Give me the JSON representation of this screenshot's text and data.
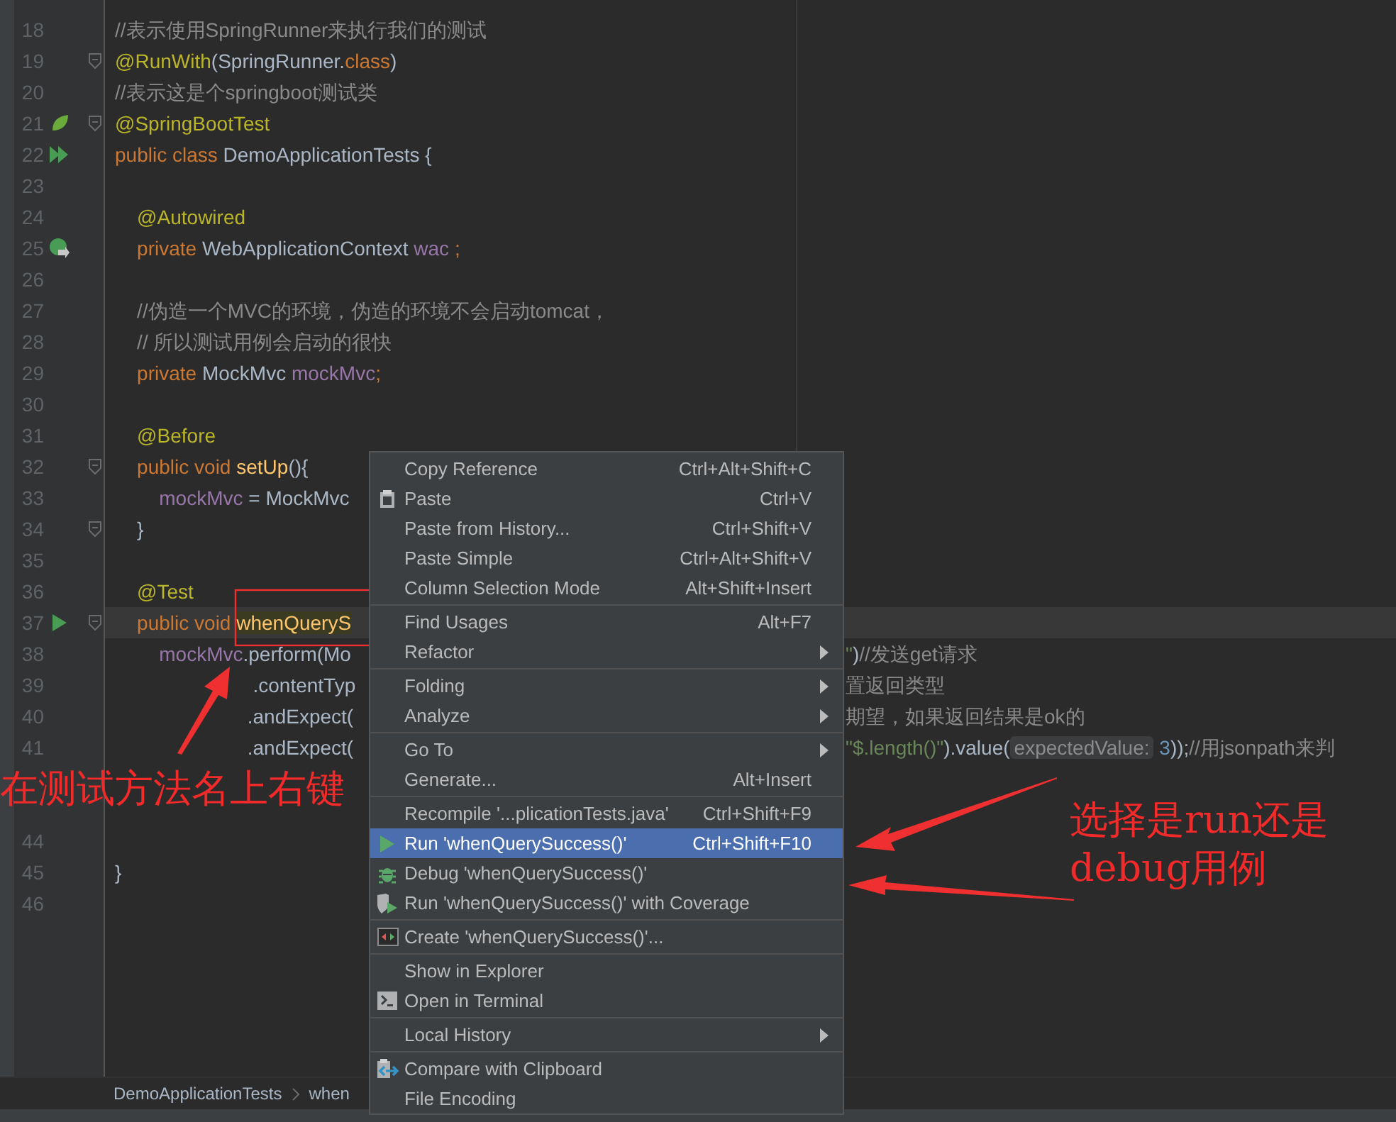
{
  "editor": {
    "lines": [
      {
        "number": "18",
        "kind": "plain",
        "fold": false,
        "current": false,
        "tokens": [
          {
            "kind": "comment",
            "text": "//表示使用SpringRunner来执行我们的测试"
          }
        ]
      },
      {
        "number": "19",
        "kind": "plain",
        "fold": true,
        "current": false,
        "tokens": [
          {
            "kind": "annotation",
            "text": "@RunWith"
          },
          {
            "kind": "plain",
            "text": "(SpringRunner."
          },
          {
            "kind": "keyword",
            "text": "class"
          },
          {
            "kind": "plain",
            "text": ")"
          }
        ]
      },
      {
        "number": "20",
        "kind": "plain",
        "fold": false,
        "current": false,
        "tokens": [
          {
            "kind": "comment",
            "text": "//表示这是个springboot测试类"
          }
        ]
      },
      {
        "number": "21",
        "kind": "leaf",
        "fold": true,
        "current": false,
        "tokens": [
          {
            "kind": "annotation",
            "text": "@SpringBootTest"
          }
        ]
      },
      {
        "number": "22",
        "kind": "run-all",
        "fold": false,
        "current": false,
        "tokens": [
          {
            "kind": "keyword",
            "text": "public class "
          },
          {
            "kind": "plain",
            "text": "DemoApplicationTests {"
          }
        ]
      },
      {
        "number": "23",
        "kind": "plain",
        "fold": false,
        "current": false
      },
      {
        "number": "24",
        "kind": "plain",
        "fold": false,
        "current": false,
        "tokens": [
          {
            "kind": "annotation",
            "text": "    @Autowired"
          }
        ]
      },
      {
        "number": "25",
        "kind": "bean",
        "fold": false,
        "current": false,
        "tokens": [
          {
            "kind": "keyword",
            "text": "    private "
          },
          {
            "kind": "plain",
            "text": "WebApplicationContext "
          },
          {
            "kind": "field",
            "text": "wac "
          },
          {
            "kind": "keyword",
            "text": ";"
          }
        ]
      },
      {
        "number": "26",
        "kind": "plain",
        "fold": false,
        "current": false
      },
      {
        "number": "27",
        "kind": "plain",
        "fold": false,
        "current": false,
        "tokens": [
          {
            "kind": "comment",
            "text": "    //伪造一个MVC的环境，伪造的环境不会启动tomcat，"
          }
        ]
      },
      {
        "number": "28",
        "kind": "plain",
        "fold": false,
        "current": false,
        "tokens": [
          {
            "kind": "comment",
            "text": "    // 所以测试用例会启动的很快"
          }
        ]
      },
      {
        "number": "29",
        "kind": "plain",
        "fold": false,
        "current": false,
        "tokens": [
          {
            "kind": "keyword",
            "text": "    private "
          },
          {
            "kind": "plain",
            "text": "MockMvc "
          },
          {
            "kind": "field",
            "text": "mockMvc"
          },
          {
            "kind": "keyword",
            "text": ";"
          }
        ]
      },
      {
        "number": "30",
        "kind": "plain",
        "fold": false,
        "current": false
      },
      {
        "number": "31",
        "kind": "plain",
        "fold": false,
        "current": false,
        "tokens": [
          {
            "kind": "annotation",
            "text": "    @Before"
          }
        ]
      },
      {
        "number": "32",
        "kind": "plain",
        "fold": true,
        "current": false,
        "tokens": [
          {
            "kind": "keyword",
            "text": "    public void "
          },
          {
            "kind": "method",
            "text": "setUp"
          },
          {
            "kind": "plain",
            "text": "(){"
          }
        ]
      },
      {
        "number": "33",
        "kind": "plain",
        "fold": false,
        "current": false,
        "tokens": [
          {
            "kind": "field",
            "text": "        mockMvc"
          },
          {
            "kind": "plain",
            "text": " = MockMvc"
          }
        ]
      },
      {
        "number": "34",
        "kind": "plain",
        "fold": true,
        "current": false,
        "tokens": [
          {
            "kind": "plain",
            "text": "    }"
          }
        ]
      },
      {
        "number": "35",
        "kind": "plain",
        "fold": false,
        "current": false
      },
      {
        "number": "36",
        "kind": "plain",
        "fold": false,
        "current": false,
        "tokens": [
          {
            "kind": "annotation",
            "text": "    @Test"
          }
        ]
      },
      {
        "number": "37",
        "kind": "run",
        "fold": true,
        "current": true,
        "tokens": [
          {
            "kind": "keyword",
            "text": "    public void "
          },
          {
            "kind": "method-highlight",
            "text": "whenQueryS"
          }
        ]
      },
      {
        "number": "38",
        "kind": "plain",
        "fold": false,
        "current": false,
        "tokens": [
          {
            "kind": "field",
            "text": "        mockMvc"
          },
          {
            "kind": "plain",
            "text": ".perform(Mo"
          }
        ],
        "tail": [
          {
            "kind": "string",
            "text": "\""
          },
          {
            "kind": "plain",
            "text": ")"
          },
          {
            "kind": "comment",
            "text": "//发送get请求"
          }
        ]
      },
      {
        "number": "39",
        "kind": "plain",
        "fold": false,
        "current": false,
        "tokens": [
          {
            "kind": "plain",
            "text": "                         .contentTyp"
          }
        ],
        "tail": [
          {
            "kind": "comment",
            "text": "置返回类型"
          }
        ]
      },
      {
        "number": "40",
        "kind": "plain",
        "fold": false,
        "current": false,
        "tokens": [
          {
            "kind": "plain",
            "text": "                        .andExpect("
          }
        ],
        "tail": [
          {
            "kind": "comment",
            "text": "期望，如果返回结果是ok的"
          }
        ]
      },
      {
        "number": "41",
        "kind": "plain",
        "fold": false,
        "current": false,
        "tokens": [
          {
            "kind": "plain",
            "text": "                        .andExpect("
          }
        ],
        "tail": [
          {
            "kind": "string",
            "text": "\"$.length()\""
          },
          {
            "kind": "plain",
            "text": ").value("
          },
          {
            "kind": "hint",
            "text": "expectedValue:"
          },
          {
            "kind": "number",
            "text": " 3"
          },
          {
            "kind": "plain",
            "text": "));"
          },
          {
            "kind": "comment",
            "text": "//用jsonpath来判"
          }
        ]
      },
      {
        "kind": "plain",
        "fold": false,
        "current": false
      },
      {
        "kind": "plain",
        "fold": false,
        "current": false
      },
      {
        "number": "44",
        "kind": "plain",
        "fold": false,
        "current": false
      },
      {
        "number": "45",
        "kind": "plain",
        "fold": false,
        "current": false,
        "tokens": [
          {
            "kind": "plain",
            "text": "}"
          }
        ]
      },
      {
        "number": "46",
        "kind": "plain",
        "fold": false,
        "current": false
      }
    ]
  },
  "breadcrumbs": [
    "DemoApplicationTests",
    "when"
  ],
  "context_menu": [
    {
      "kind": "plain",
      "label": "Copy Reference",
      "shortcut": "Ctrl+Alt+Shift+C",
      "submenu": false,
      "selected": false
    },
    {
      "kind": "clipboard",
      "label": "Paste",
      "shortcut": "Ctrl+V",
      "submenu": false,
      "selected": false
    },
    {
      "kind": "plain",
      "label": "Paste from History...",
      "shortcut": "Ctrl+Shift+V",
      "submenu": false,
      "selected": false
    },
    {
      "kind": "plain",
      "label": "Paste Simple",
      "shortcut": "Ctrl+Alt+Shift+V",
      "submenu": false,
      "selected": false
    },
    {
      "kind": "plain",
      "label": "Column Selection Mode",
      "shortcut": "Alt+Shift+Insert",
      "submenu": false,
      "selected": false
    },
    {
      "kind": "separator"
    },
    {
      "kind": "plain",
      "label": "Find Usages",
      "shortcut": "Alt+F7",
      "submenu": false,
      "selected": false
    },
    {
      "kind": "plain",
      "label": "Refactor",
      "submenu": true,
      "selected": false
    },
    {
      "kind": "separator"
    },
    {
      "kind": "plain",
      "label": "Folding",
      "submenu": true,
      "selected": false
    },
    {
      "kind": "plain",
      "label": "Analyze",
      "submenu": true,
      "selected": false
    },
    {
      "kind": "separator"
    },
    {
      "kind": "plain",
      "label": "Go To",
      "submenu": true,
      "selected": false
    },
    {
      "kind": "plain",
      "label": "Generate...",
      "shortcut": "Alt+Insert",
      "submenu": false,
      "selected": false
    },
    {
      "kind": "separator"
    },
    {
      "kind": "plain",
      "label": "Recompile '...plicationTests.java'",
      "shortcut": "Ctrl+Shift+F9",
      "submenu": false,
      "selected": false
    },
    {
      "kind": "run",
      "label": "Run 'whenQuerySuccess()'",
      "shortcut": "Ctrl+Shift+F10",
      "submenu": false,
      "selected": true
    },
    {
      "kind": "debug",
      "label": "Debug 'whenQuerySuccess()'",
      "submenu": false,
      "selected": false
    },
    {
      "kind": "coverage",
      "label": "Run 'whenQuerySuccess()' with Coverage",
      "submenu": false,
      "selected": false
    },
    {
      "kind": "separator"
    },
    {
      "kind": "create",
      "label": "Create 'whenQuerySuccess()'...",
      "submenu": false,
      "selected": false
    },
    {
      "kind": "separator"
    },
    {
      "kind": "plain",
      "label": "Show in Explorer",
      "submenu": false,
      "selected": false
    },
    {
      "kind": "terminal",
      "label": "Open in Terminal",
      "submenu": false,
      "selected": false
    },
    {
      "kind": "separator"
    },
    {
      "kind": "plain",
      "label": "Local History",
      "submenu": true,
      "selected": false
    },
    {
      "kind": "separator"
    },
    {
      "kind": "compare",
      "label": "Compare with Clipboard",
      "submenu": false,
      "selected": false
    },
    {
      "kind": "plain",
      "label": "File Encoding",
      "submenu": false,
      "selected": false
    }
  ],
  "annotations": [
    {
      "kind": "left",
      "text": "在测试方法名上右键"
    },
    {
      "kind": "right",
      "text": "选择是run还是\ndebug用例"
    }
  ]
}
